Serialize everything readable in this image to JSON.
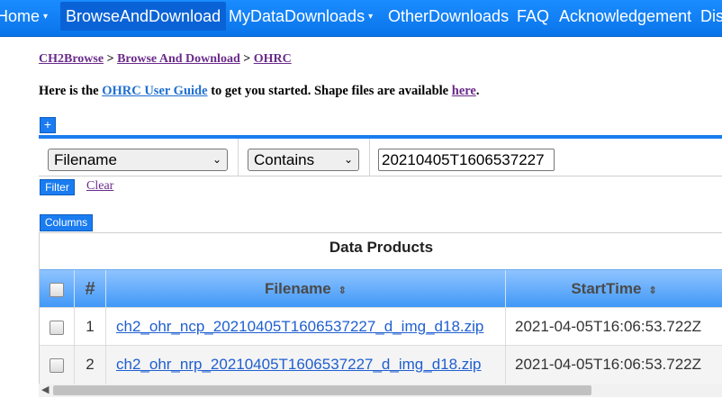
{
  "navbar": {
    "items": [
      {
        "label": "Home",
        "caret": "▾"
      },
      {
        "label": "BrowseAndDownload",
        "active": true
      },
      {
        "label": "MyDataDownloads",
        "caret": "▾"
      },
      {
        "label": "OtherDownloads"
      },
      {
        "label": "FAQ"
      },
      {
        "label": "Acknowledgement"
      },
      {
        "label": "Dis"
      }
    ]
  },
  "breadcrumb": {
    "items": [
      "CH2Browse",
      "Browse And Download",
      "OHRC"
    ],
    "separator": ">"
  },
  "intro": {
    "text_before": "Here is the",
    "guide_link": "OHRC User Guide",
    "text_middle": "to get you started. Shape files are available",
    "here_link": "here",
    "text_end": "."
  },
  "controls": {
    "add_filter_label": "+",
    "filter_label": "Filter",
    "clear_label": "Clear",
    "columns_label": "Columns"
  },
  "filter": {
    "field_value": "Filename",
    "operator_value": "Contains",
    "search_value": "20210405T1606537227"
  },
  "table": {
    "caption": "Data Products",
    "headers": {
      "index": "#",
      "filename": "Filename",
      "starttime": "StartTime"
    },
    "sort_icon": "⇕",
    "rows": [
      {
        "index": "1",
        "filename": "ch2_ohr_ncp_20210405T1606537227_d_img_d18.zip",
        "starttime": "2021-04-05T16:06:53.722Z"
      },
      {
        "index": "2",
        "filename": "ch2_ohr_nrp_20210405T1606537227_d_img_d18.zip",
        "starttime": "2021-04-05T16:06:53.722Z"
      }
    ]
  },
  "colors": {
    "navbar": "#0a74ea",
    "header_gradient_top": "#8fc4ff",
    "header_gradient_bottom": "#3f97f7",
    "link": "#1f5fd0",
    "visited_link": "#6a2b8a"
  }
}
